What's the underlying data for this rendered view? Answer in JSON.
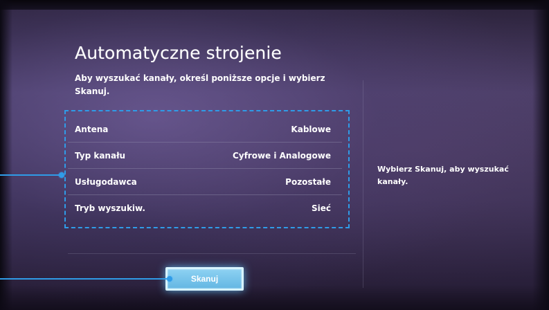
{
  "screen": {
    "title": "Automatyczne strojenie",
    "description": "Aby wyszukać kanały, określ poniższe opcje i wybierz Skanuj."
  },
  "options": [
    {
      "label": "Antena",
      "value": "Kablowe"
    },
    {
      "label": "Typ kanału",
      "value": "Cyfrowe i Analogowe"
    },
    {
      "label": "Usługodawca",
      "value": "Pozostałe"
    },
    {
      "label": "Tryb wyszukiw.",
      "value": "Sieć"
    }
  ],
  "actions": {
    "scan_button_label": "Skanuj"
  },
  "help": {
    "text": "Wybierz Skanuj, aby wyszukać kanały."
  },
  "colors": {
    "highlight_outline": "#2f9ce8",
    "button_fill": "#7ccaf0",
    "text": "#ffffff"
  }
}
